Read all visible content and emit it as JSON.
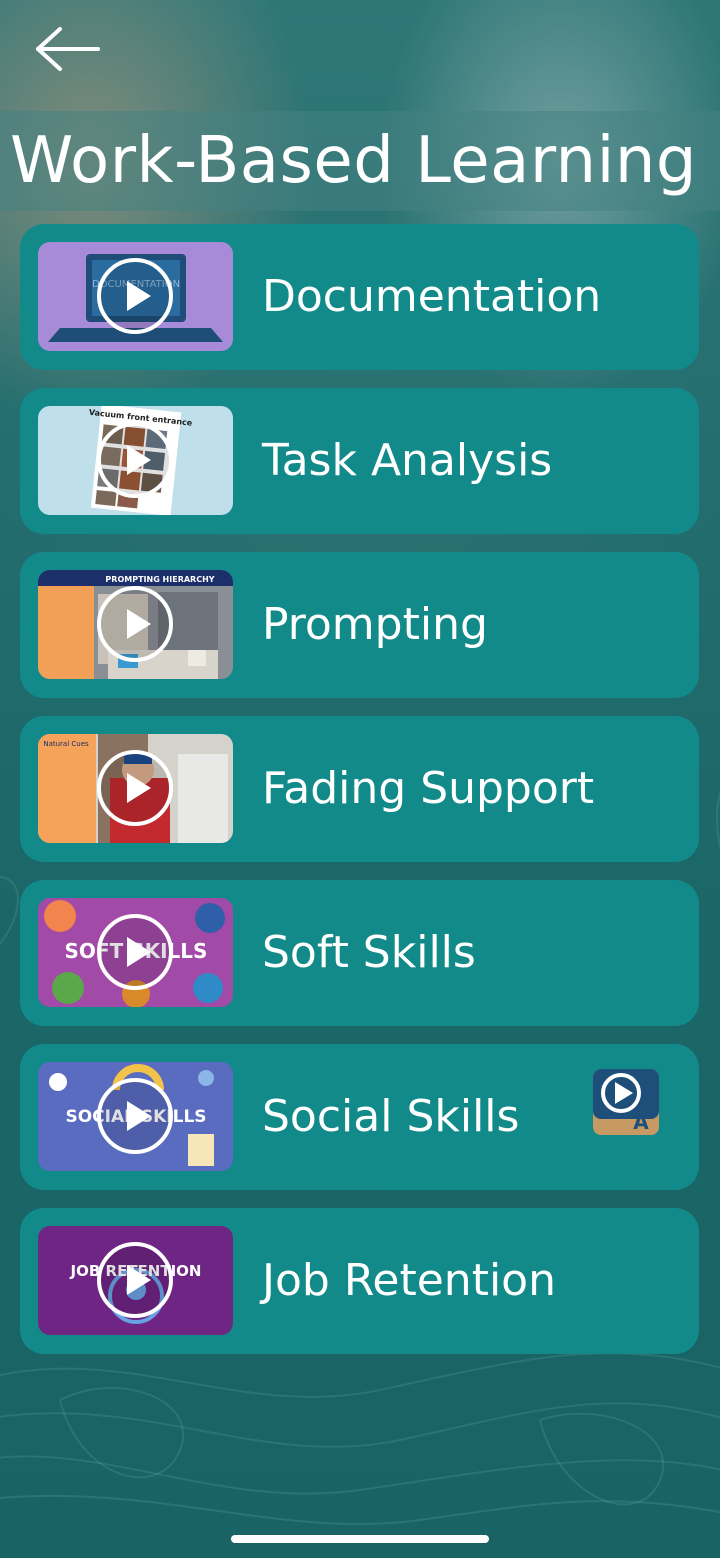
{
  "header": {
    "title": "Work-Based Learning",
    "back_icon": "arrow-left-icon"
  },
  "modules": [
    {
      "label": "Documentation",
      "thumb_text": "DOCUMENTATION",
      "thumb_color": "#a78bd8"
    },
    {
      "label": "Task Analysis",
      "thumb_text": "Vacuum front entrance",
      "thumb_color": "#bfe0ea"
    },
    {
      "label": "Prompting",
      "thumb_text": "PROMPTING HIERARCHY",
      "thumb_color": "#1d2f6a"
    },
    {
      "label": "Fading Support",
      "thumb_text": "Natural Cues",
      "thumb_color": "#f5a25a"
    },
    {
      "label": "Soft Skills",
      "thumb_text": "SOFT SKILLS",
      "thumb_color": "#a24aa8"
    },
    {
      "label": "Social Skills",
      "thumb_text": "SOCIAL SKILLS",
      "thumb_color": "#5a6cc0",
      "badge": "asl-video-icon"
    },
    {
      "label": "Job Retention",
      "thumb_text": "JOB RETENTION",
      "thumb_color": "#6f2584"
    }
  ],
  "colors": {
    "card": "#138a8a",
    "background": "#1f6e6e",
    "text": "#ffffff"
  }
}
